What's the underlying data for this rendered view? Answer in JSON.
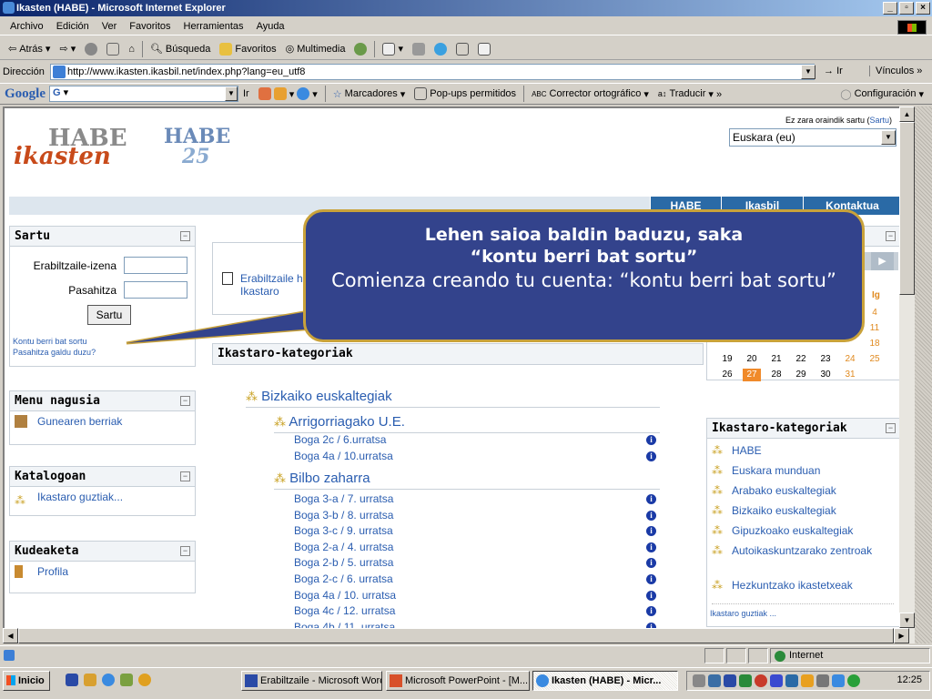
{
  "window": {
    "title": "Ikasten (HABE) - Microsoft Internet Explorer"
  },
  "menu": [
    "Archivo",
    "Edición",
    "Ver",
    "Favoritos",
    "Herramientas",
    "Ayuda"
  ],
  "toolbar": {
    "back": "Atrás",
    "search": "Búsqueda",
    "favorites": "Favoritos",
    "media": "Multimedia"
  },
  "address": {
    "label": "Dirección",
    "url": "http://www.ikasten.ikasbil.net/index.php?lang=eu_utf8",
    "go": "Ir",
    "links": "Vínculos"
  },
  "googlebar": {
    "logo": "Google",
    "g": "G",
    "ir": "Ir",
    "bookmarks": "Marcadores",
    "popups": "Pop-ups permitidos",
    "spell": "Corrector ortográfico",
    "translate": "Traducir",
    "settings": "Configuración"
  },
  "page": {
    "logo1": "ikasten HABE",
    "logo2": "HABE 25 urte",
    "lang_note_prefix": "Ez zara oraindik sartu (",
    "lang_note_link": "Sartu",
    "lang_note_suffix": ")",
    "lang_select": "Euskara (eu)",
    "nav": [
      "HABE",
      "Ikasbil",
      "Kontaktua"
    ],
    "login": {
      "title": "Sartu",
      "user_label": "Erabiltzaile-izena",
      "pass_label": "Pasahitza",
      "button": "Sartu",
      "new_account": "Kontu berri bat sortu",
      "forgot": "Pasahitza galdu duzu?"
    },
    "middle_links": [
      "Erabiltzaile h",
      "Ikastaro"
    ],
    "main_menu": {
      "title": "Menu nagusia",
      "items": [
        "Gunearen berriak"
      ]
    },
    "catalog": {
      "title": "Katalogoan",
      "items": [
        "Ikastaro guztiak..."
      ]
    },
    "admin": {
      "title": "Kudeaketa",
      "items": [
        "Profila"
      ]
    },
    "categories_header": "Ikastaro-kategoriak",
    "tree": {
      "root": "Bizkaiko euskaltegiak",
      "groups": [
        {
          "name": "Arrigorriagako U.E.",
          "courses": [
            "Boga 2c / 6.urratsa",
            "Boga 4a / 10.urratsa"
          ]
        },
        {
          "name": "Bilbo zaharra",
          "courses": [
            "Boga 3-a / 7. urratsa",
            "Boga 3-b / 8. urratsa",
            "Boga 3-c / 9. urratsa",
            "Boga 2-a / 4. urratsa",
            "Boga 2-b / 5. urratsa",
            "Boga 2-c / 6. urratsa",
            "Boga 4a / 10. urratsa",
            "Boga 4c / 12. urratsa",
            "Boga 4b / 11. urratsa"
          ]
        }
      ]
    },
    "calendar": {
      "day_partial": "Ig",
      "rows": [
        [
          "",
          "",
          "",
          "",
          "",
          "",
          "4"
        ],
        [
          "",
          "",
          "",
          "",
          "",
          "",
          "11"
        ],
        [
          "",
          "",
          "",
          "",
          "",
          "",
          "18"
        ],
        [
          "19",
          "20",
          "21",
          "22",
          "23",
          "24",
          "25"
        ],
        [
          "26",
          "27",
          "28",
          "29",
          "30",
          "31",
          ""
        ]
      ],
      "today": "27"
    },
    "right_categories": {
      "title": "Ikastaro-kategoriak",
      "items": [
        "HABE",
        "Euskara munduan",
        "Arabako euskaltegiak",
        "Bizkaiko euskaltegiak",
        "Gipuzkoako euskaltegiak",
        "Autoikaskuntzarako zentroak",
        "Hezkuntzako ikastetxeak"
      ],
      "all": "Ikastaro guztiak ..."
    }
  },
  "callout": {
    "line1": "Lehen saioa baldin baduzu, saka",
    "line2": "“kontu berri bat sortu”",
    "line3": "Comienza creando tu cuenta: “kontu berri bat sortu”"
  },
  "status": {
    "zone": "Internet"
  },
  "taskbar": {
    "start": "Inicio",
    "tasks": [
      "Erabiltzaile - Microsoft Word",
      "Microsoft PowerPoint - [M...",
      "Ikasten (HABE) - Micr..."
    ],
    "clock": "12:25"
  },
  "colors": {
    "accent": "#2a6aa6",
    "link": "#2a5db0",
    "callout_bg": "#33438c",
    "callout_border": "#c9a23a"
  }
}
